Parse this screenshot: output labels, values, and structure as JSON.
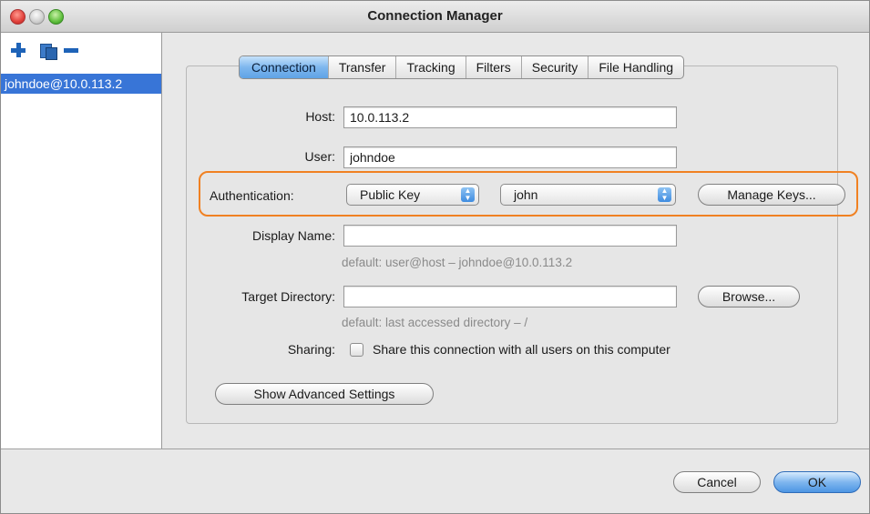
{
  "window": {
    "title": "Connection Manager"
  },
  "sidebar": {
    "tools": [
      "add-icon",
      "duplicate-icon",
      "remove-icon"
    ],
    "items": [
      {
        "label": "johndoe@10.0.113.2",
        "selected": true
      }
    ]
  },
  "tabs": [
    {
      "label": "Connection",
      "active": true
    },
    {
      "label": "Transfer",
      "active": false
    },
    {
      "label": "Tracking",
      "active": false
    },
    {
      "label": "Filters",
      "active": false
    },
    {
      "label": "Security",
      "active": false
    },
    {
      "label": "File Handling",
      "active": false
    }
  ],
  "form": {
    "host": {
      "label": "Host:",
      "value": "10.0.113.2"
    },
    "user": {
      "label": "User:",
      "value": "johndoe"
    },
    "authentication": {
      "label": "Authentication:",
      "method": "Public Key",
      "key": "john",
      "manage_keys_label": "Manage Keys..."
    },
    "display_name": {
      "label": "Display Name:",
      "value": "",
      "hint": "default: user@host – johndoe@10.0.113.2"
    },
    "target_directory": {
      "label": "Target Directory:",
      "value": "",
      "browse_label": "Browse...",
      "hint": "default: last accessed directory – /"
    },
    "sharing": {
      "label": "Sharing:",
      "checkbox_label": "Share this connection with all users on this computer",
      "checked": false
    },
    "advanced_label": "Show Advanced Settings"
  },
  "footer": {
    "cancel_label": "Cancel",
    "ok_label": "OK"
  },
  "colors": {
    "accent": "#3875d7",
    "highlight": "#f08122"
  }
}
